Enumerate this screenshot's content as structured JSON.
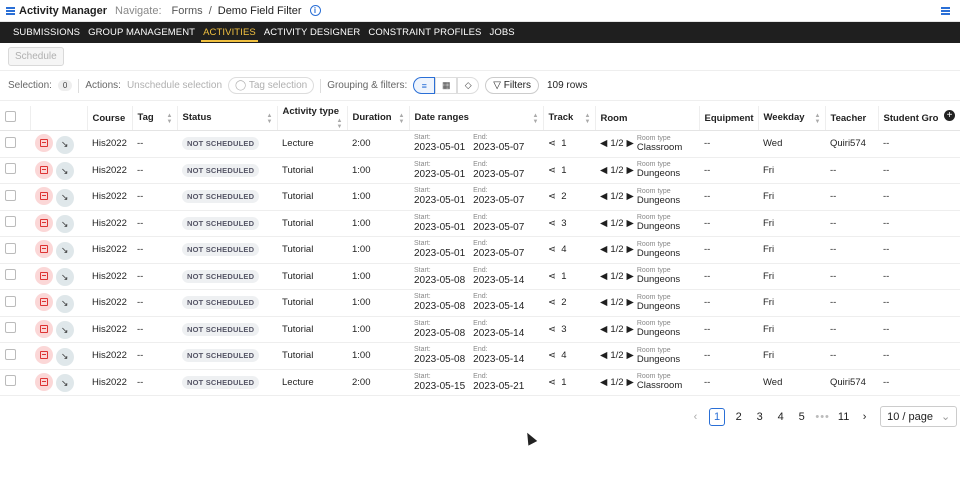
{
  "header": {
    "app_title": "Activity Manager",
    "navigate_label": "Navigate:",
    "breadcrumb_parent": "Forms",
    "breadcrumb_sep": "/",
    "breadcrumb_current": "Demo Field Filter"
  },
  "nav": {
    "tabs": [
      "SUBMISSIONS",
      "GROUP MANAGEMENT",
      "ACTIVITIES",
      "ACTIVITY DESIGNER",
      "CONSTRAINT PROFILES",
      "JOBS"
    ],
    "active": "ACTIVITIES"
  },
  "schedule_button": "Schedule",
  "toolbar": {
    "selection_label": "Selection:",
    "selection_count": "0",
    "actions_label": "Actions:",
    "unschedule": "Unschedule selection",
    "tag_selection": "Tag selection",
    "grouping_label": "Grouping & filters:",
    "filters": "Filters",
    "rows": "109 rows"
  },
  "columns": [
    "Course",
    "Tag",
    "Status",
    "Activity type",
    "Duration",
    "Date ranges",
    "Track",
    "Room",
    "Equipment",
    "Weekday",
    "Teacher",
    "Student Gro"
  ],
  "labels": {
    "start": "Start:",
    "end": "End:",
    "room_type": "Room type",
    "room_nav": "1/2"
  },
  "rows": [
    {
      "course": "His2022",
      "tag": "--",
      "status": "NOT SCHEDULED",
      "type": "Lecture",
      "duration": "2:00",
      "start": "2023-05-01",
      "end": "2023-05-07",
      "track": "1",
      "room": "Classroom",
      "equipment": "--",
      "weekday": "Wed",
      "teacher": "Quiri574",
      "group": "--"
    },
    {
      "course": "His2022",
      "tag": "--",
      "status": "NOT SCHEDULED",
      "type": "Tutorial",
      "duration": "1:00",
      "start": "2023-05-01",
      "end": "2023-05-07",
      "track": "1",
      "room": "Dungeons",
      "equipment": "--",
      "weekday": "Fri",
      "teacher": "--",
      "group": "--"
    },
    {
      "course": "His2022",
      "tag": "--",
      "status": "NOT SCHEDULED",
      "type": "Tutorial",
      "duration": "1:00",
      "start": "2023-05-01",
      "end": "2023-05-07",
      "track": "2",
      "room": "Dungeons",
      "equipment": "--",
      "weekday": "Fri",
      "teacher": "--",
      "group": "--"
    },
    {
      "course": "His2022",
      "tag": "--",
      "status": "NOT SCHEDULED",
      "type": "Tutorial",
      "duration": "1:00",
      "start": "2023-05-01",
      "end": "2023-05-07",
      "track": "3",
      "room": "Dungeons",
      "equipment": "--",
      "weekday": "Fri",
      "teacher": "--",
      "group": "--"
    },
    {
      "course": "His2022",
      "tag": "--",
      "status": "NOT SCHEDULED",
      "type": "Tutorial",
      "duration": "1:00",
      "start": "2023-05-01",
      "end": "2023-05-07",
      "track": "4",
      "room": "Dungeons",
      "equipment": "--",
      "weekday": "Fri",
      "teacher": "--",
      "group": "--"
    },
    {
      "course": "His2022",
      "tag": "--",
      "status": "NOT SCHEDULED",
      "type": "Tutorial",
      "duration": "1:00",
      "start": "2023-05-08",
      "end": "2023-05-14",
      "track": "1",
      "room": "Dungeons",
      "equipment": "--",
      "weekday": "Fri",
      "teacher": "--",
      "group": "--"
    },
    {
      "course": "His2022",
      "tag": "--",
      "status": "NOT SCHEDULED",
      "type": "Tutorial",
      "duration": "1:00",
      "start": "2023-05-08",
      "end": "2023-05-14",
      "track": "2",
      "room": "Dungeons",
      "equipment": "--",
      "weekday": "Fri",
      "teacher": "--",
      "group": "--"
    },
    {
      "course": "His2022",
      "tag": "--",
      "status": "NOT SCHEDULED",
      "type": "Tutorial",
      "duration": "1:00",
      "start": "2023-05-08",
      "end": "2023-05-14",
      "track": "3",
      "room": "Dungeons",
      "equipment": "--",
      "weekday": "Fri",
      "teacher": "--",
      "group": "--"
    },
    {
      "course": "His2022",
      "tag": "--",
      "status": "NOT SCHEDULED",
      "type": "Tutorial",
      "duration": "1:00",
      "start": "2023-05-08",
      "end": "2023-05-14",
      "track": "4",
      "room": "Dungeons",
      "equipment": "--",
      "weekday": "Fri",
      "teacher": "--",
      "group": "--"
    },
    {
      "course": "His2022",
      "tag": "--",
      "status": "NOT SCHEDULED",
      "type": "Lecture",
      "duration": "2:00",
      "start": "2023-05-15",
      "end": "2023-05-21",
      "track": "1",
      "room": "Classroom",
      "equipment": "--",
      "weekday": "Wed",
      "teacher": "Quiri574",
      "group": "--"
    }
  ],
  "pagination": {
    "pages": [
      "1",
      "2",
      "3",
      "4",
      "5"
    ],
    "dots": "•••",
    "last": "11",
    "current": "1",
    "page_size": "10 / page"
  }
}
